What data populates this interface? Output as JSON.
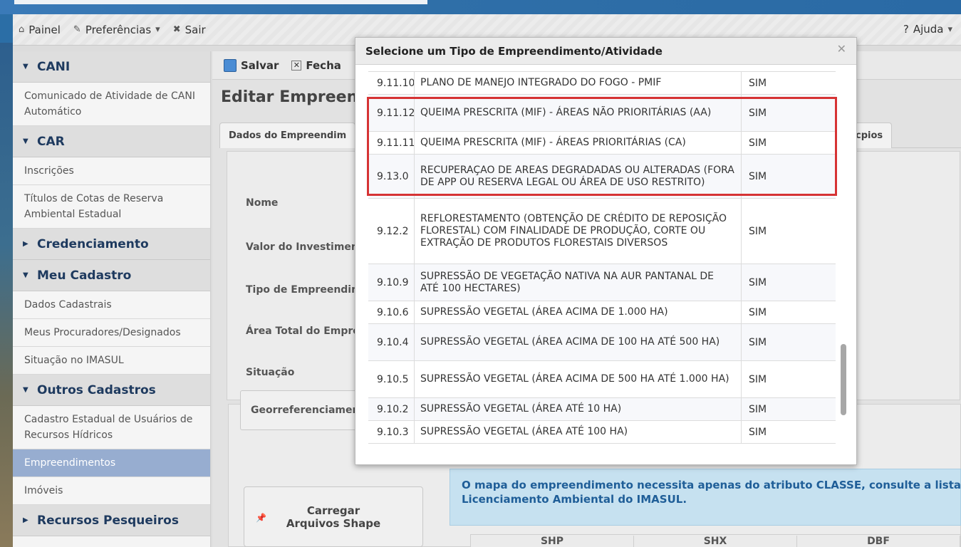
{
  "topnav": {
    "items": [
      {
        "icon": "home-icon",
        "label": "Painel"
      },
      {
        "icon": "wrench-icon",
        "label": "Preferências"
      },
      {
        "icon": "close-icon",
        "label": "Sair"
      }
    ],
    "help": {
      "label": "Ajuda",
      "prefix": "?"
    }
  },
  "sidebar": {
    "groups": [
      {
        "title": "CANI",
        "items": [
          "Comunicado de Atividade de CANI Automático"
        ]
      },
      {
        "title": "CAR",
        "items": [
          "Inscrições",
          "Títulos de Cotas de Reserva Ambiental Estadual"
        ]
      },
      {
        "title": "Credenciamento",
        "items": []
      },
      {
        "title": "Meu Cadastro",
        "items": [
          "Dados Cadastrais",
          "Meus Procuradores/Designados",
          "Situação no IMASUL"
        ]
      },
      {
        "title": "Outros Cadastros",
        "items": [
          "Cadastro Estadual de Usuários de Recursos Hídricos",
          "Empreendimentos",
          "Imóveis"
        ]
      },
      {
        "title": "Recursos Pesqueiros",
        "items": []
      }
    ]
  },
  "toolbar": {
    "save_label": "Salvar",
    "close_label": "Fecha"
  },
  "page": {
    "title": "Editar Empreend"
  },
  "tabs": {
    "active": "Dados do Empreendim",
    "right": "cpios"
  },
  "form": {
    "labels": [
      "Nome",
      "Valor do Investimen",
      "Tipo de Empreendim",
      "Área Total do Empre",
      "Situação"
    ]
  },
  "geo": {
    "tab_label": "Georreferenciament",
    "upload_label": "Carregar Arquivos Shape"
  },
  "info": {
    "line1": "O mapa do empreendimento necessita apenas do atributo CLASSE, consulte a lista c",
    "line2": "Licenciamento Ambiental do IMASUL."
  },
  "files": {
    "headers": [
      "SHP",
      "SHX",
      "DBF"
    ]
  },
  "modal": {
    "title": "Selecione um Tipo de Empreendimento/Atividade",
    "rows": [
      {
        "code": "9.11.10",
        "desc": "PLANO DE MANEJO INTEGRADO DO FOGO - PMIF",
        "flag": "SIM"
      },
      {
        "code": "9.11.12",
        "desc": "QUEIMA PRESCRITA (MIF) - ÁREAS NÃO PRIORITÁRIAS (AA)",
        "flag": "SIM"
      },
      {
        "code": "9.11.11",
        "desc": "QUEIMA PRESCRITA (MIF) - ÁREAS PRIORITÁRIAS (CA)",
        "flag": "SIM"
      },
      {
        "code": "9.13.0",
        "desc": "RECUPERAÇAO DE AREAS DEGRADADAS OU ALTERADAS (FORA DE APP OU RESERVA LEGAL OU ÁREA DE USO RESTRITO)",
        "flag": "SIM"
      },
      {
        "code": "9.12.2",
        "desc": "REFLORESTAMENTO (OBTENÇÃO DE CRÉDITO DE REPOSIÇÃO FLORESTAL) COM FINALIDADE DE PRODUÇÃO, CORTE OU EXTRAÇÃO DE PRODUTOS FLORESTAIS DIVERSOS",
        "flag": "SIM"
      },
      {
        "code": "9.10.9",
        "desc": "SUPRESSÃO DE VEGETAÇÃO NATIVA NA AUR PANTANAL DE ATÉ 100 HECTARES)",
        "flag": "SIM"
      },
      {
        "code": "9.10.6",
        "desc": "SUPRESSÃO VEGETAL (ÁREA ACIMA DE 1.000 HA)",
        "flag": "SIM"
      },
      {
        "code": "9.10.4",
        "desc": "SUPRESSÃO VEGETAL (ÁREA ACIMA DE 100 HA ATÉ 500 HA)",
        "flag": "SIM"
      },
      {
        "code": "9.10.5",
        "desc": "SUPRESSÃO VEGETAL (ÁREA ACIMA DE 500 HA ATÉ 1.000 HA)",
        "flag": "SIM"
      },
      {
        "code": "9.10.2",
        "desc": "SUPRESSÃO VEGETAL (ÁREA ATÉ 10 HA)",
        "flag": "SIM"
      },
      {
        "code": "9.10.3",
        "desc": "SUPRESSÃO VEGETAL (ÁREA ATÉ 100 HA)",
        "flag": "SIM"
      }
    ]
  }
}
